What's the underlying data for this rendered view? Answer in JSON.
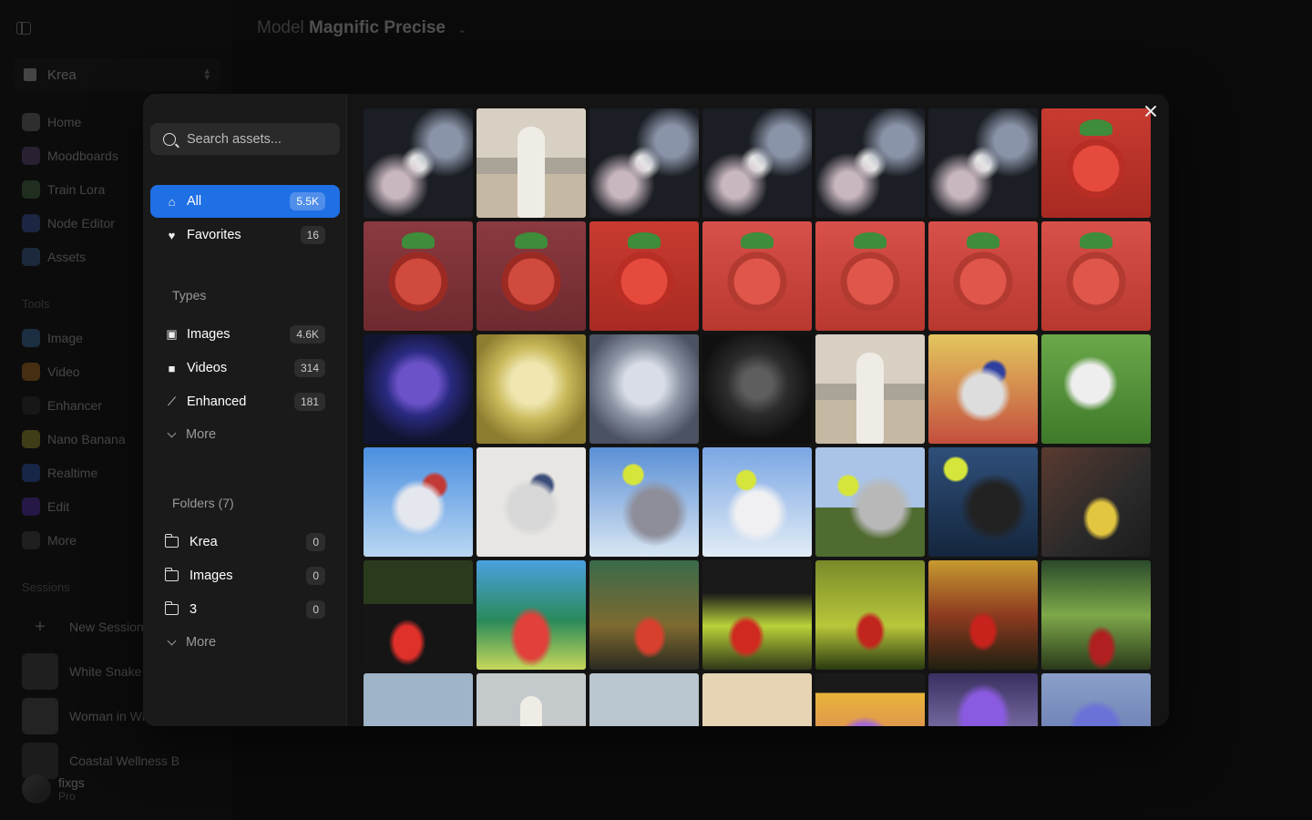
{
  "app": {
    "model_prefix": "Model",
    "model_name": "Magnific Precise",
    "workspace": "Krea",
    "nav": [
      {
        "label": "Home",
        "color": "#8a8a8a"
      },
      {
        "label": "Moodboards",
        "color": "#7a5a9a"
      },
      {
        "label": "Train Lora",
        "color": "#5a8a5a"
      },
      {
        "label": "Node Editor",
        "color": "#4a6ad0"
      },
      {
        "label": "Assets",
        "color": "#4a7ac0"
      }
    ],
    "tools_label": "Tools",
    "tools": [
      {
        "label": "Image",
        "color": "#4a8ad0"
      },
      {
        "label": "Video",
        "color": "#e08a2a"
      },
      {
        "label": "Enhancer",
        "color": "#3a3a3a"
      },
      {
        "label": "Nano Banana",
        "color": "#c9c23a"
      },
      {
        "label": "Realtime",
        "color": "#3a6ae0"
      },
      {
        "label": "Edit",
        "color": "#6a3ae0"
      },
      {
        "label": "More",
        "color": "#555555"
      }
    ],
    "sessions_label": "Sessions",
    "new_session": "New Session",
    "sessions": [
      {
        "label": "White Snake"
      },
      {
        "label": "Woman in Wh"
      },
      {
        "label": "Coastal Wellness B"
      }
    ],
    "user": {
      "name": "fixgs",
      "plan": "Pro"
    }
  },
  "modal": {
    "search_placeholder": "Search assets...",
    "primary": [
      {
        "label": "All",
        "count": "5.5K",
        "active": true,
        "icon": "home-icon"
      },
      {
        "label": "Favorites",
        "count": "16",
        "active": false,
        "icon": "heart-icon"
      }
    ],
    "types_label": "Types",
    "types": [
      {
        "label": "Images",
        "count": "4.6K",
        "icon": "image-icon"
      },
      {
        "label": "Videos",
        "count": "314",
        "icon": "video-icon"
      },
      {
        "label": "Enhanced",
        "count": "181",
        "icon": "enhance-icon"
      }
    ],
    "types_more": "More",
    "folders_label": "Folders (7)",
    "folders": [
      {
        "label": "Krea",
        "count": "0"
      },
      {
        "label": "Images",
        "count": "0"
      },
      {
        "label": "3",
        "count": "0"
      }
    ],
    "folders_more": "More",
    "accent": "#1f6fe5",
    "assets": [
      "snake",
      "woman",
      "snake",
      "snake",
      "snake",
      "snake",
      "straw",
      "straw dark",
      "straw dark",
      "straw",
      "straw soft",
      "straw soft",
      "straw soft",
      "straw soft",
      "dragon-purple",
      "dragon-gold",
      "dragon-silver",
      "dragon-black",
      "woman",
      "horse-gold",
      "horse-green",
      "horse-sky",
      "horse-white",
      "tennis",
      "tennis-b",
      "tennis-c",
      "tennis-d",
      "car-road",
      "car-dark",
      "car-neon",
      "car-paint",
      "car-yellow",
      "car-hill",
      "car-red",
      "car-green",
      "beach",
      "beach-b",
      "beach-c",
      "beach-d",
      "flower",
      "shoe",
      "shoe-b"
    ]
  }
}
